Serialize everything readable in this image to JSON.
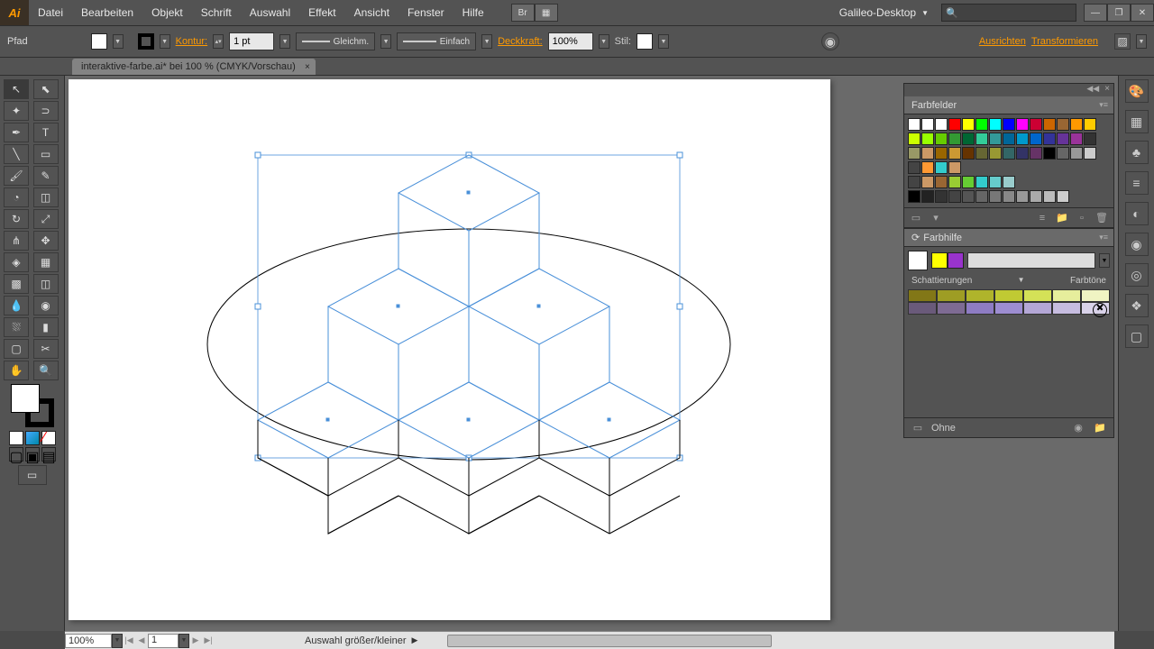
{
  "app": {
    "logo": "Ai"
  },
  "menu": [
    "Datei",
    "Bearbeiten",
    "Objekt",
    "Schrift",
    "Auswahl",
    "Effekt",
    "Ansicht",
    "Fenster",
    "Hilfe"
  ],
  "workspace": "Galileo-Desktop",
  "controlbar": {
    "tool": "Pfad",
    "stroke_label": "Kontur:",
    "stroke_pt": "1 pt",
    "brush_label": "Gleichm.",
    "style_label": "Einfach",
    "opacity_label": "Deckkraft:",
    "opacity": "100%",
    "stil_label": "Stil:",
    "align": "Ausrichten",
    "transform": "Transformieren"
  },
  "document": {
    "tab": "interaktive-farbe.ai* bei 100 % (CMYK/Vorschau)"
  },
  "panels": {
    "farbfelder": {
      "title": "Farbfelder"
    },
    "farbhilfe": {
      "title": "Farbhilfe",
      "shades_label": "Schattierungen",
      "tones_label": "Farbtöne",
      "none_label": "Ohne"
    }
  },
  "statusbar": {
    "zoom": "100%",
    "page": "1",
    "hint": "Auswahl größer/kleiner"
  },
  "swatch_rows": [
    [
      "#fff",
      "#fff",
      "#fff",
      "#ff0000",
      "#ffff00",
      "#00ff00",
      "#00ffff",
      "#0000ff",
      "#ff00ff",
      "#cc0033",
      "#cc6600",
      "#996633",
      "#ff9900",
      "#ffcc00"
    ],
    [
      "#ccff00",
      "#99ff00",
      "#66cc00",
      "#339933",
      "#006633",
      "#33cc99",
      "#339999",
      "#006699",
      "#0099cc",
      "#0066cc",
      "#333399",
      "#663399",
      "#993399",
      "#333333"
    ],
    [
      "#999966",
      "#cc9966",
      "#996600",
      "#cc9933",
      "#663300",
      "#666633",
      "#999933",
      "#336666",
      "#333366",
      "#663366",
      "#000000",
      "#666666",
      "#999999",
      "#cccccc"
    ],
    [
      "#ff9933",
      "#33cccc",
      "#cc9966"
    ],
    [
      "#cc9966",
      "#996633",
      "#99cc33",
      "#66cc33",
      "#33cccc",
      "#66cccc",
      "#99cccc"
    ],
    [
      "#000",
      "#222",
      "#333",
      "#444",
      "#555",
      "#666",
      "#777",
      "#888",
      "#999",
      "#aaa",
      "#bbb",
      "#ccc"
    ]
  ],
  "guide_colors": [
    "#ffff00",
    "#9933cc"
  ],
  "shade_row1": [
    "#827717",
    "#9e9d24",
    "#afb42b",
    "#c0ca33",
    "#d4e157",
    "#e6ee9c",
    "#f0f4c3"
  ],
  "shade_row2": [
    "#6a5a7a",
    "#7e6b93",
    "#8e7cc3",
    "#9d8dd1",
    "#b4a7d6",
    "#c6bcdf",
    "#d9d2e9"
  ]
}
